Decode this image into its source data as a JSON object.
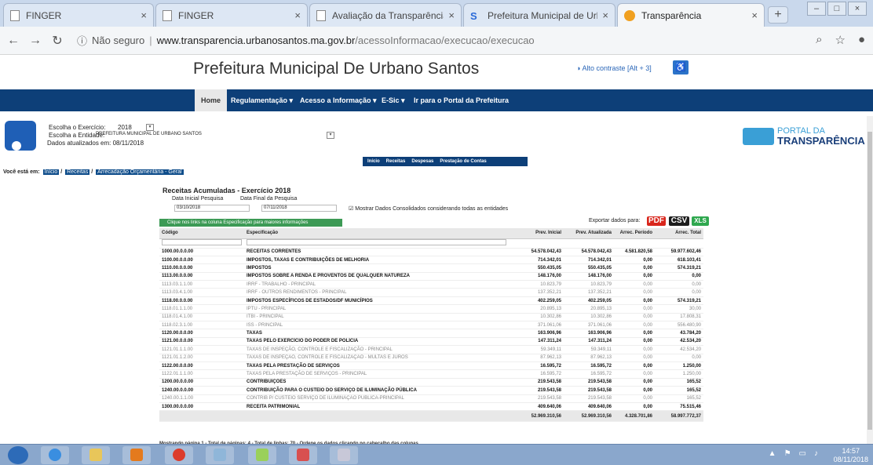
{
  "browser": {
    "tabs": [
      {
        "label": "FINGER",
        "icon": "page-icon",
        "active": false
      },
      {
        "label": "FINGER",
        "icon": "page-icon",
        "active": false
      },
      {
        "label": "Avaliação da Transparência dos",
        "icon": "page-icon",
        "active": false
      },
      {
        "label": "Prefeitura Municipal de Urbano",
        "icon": "site-icon",
        "active": false
      },
      {
        "label": "Transparência",
        "icon": "info-icon",
        "active": true
      }
    ],
    "security_label": "Não seguro",
    "url_host": "www.transparencia.urbanosantos.ma.gov.br",
    "url_path": "/acessoInformacao/execucao/execucao"
  },
  "site": {
    "title": "Prefeitura Municipal De Urbano Santos",
    "contrast_label": "Alto contraste [Alt + 3]",
    "nav": [
      "Home",
      "Regulamentação",
      "Acesso a Informação",
      "E-Sic",
      "Ir para o Portal da Prefeitura"
    ]
  },
  "portal": {
    "exercicio_label": "Escolha o Exercício:",
    "exercicio_value": "2018",
    "entidade_label": "Escolha a Entidade:",
    "entidade_value": "PREFEITURA MUNICIPAL DE URBANO SANTOS",
    "updated": "Dados atualizados em: 08/11/2018",
    "logo_line1": "PORTAL DA",
    "logo_line2": "TRANSPARÊNCIA",
    "subnav": [
      "Início",
      "Receitas",
      "Despesas",
      "Prestação de Contas"
    ],
    "breadcrumb_label": "Você está em:",
    "breadcrumb": [
      "Início",
      "Receitas",
      "Arrecadação Orçamentária - Geral"
    ]
  },
  "report": {
    "title": "Receitas Acumuladas - Exercício 2018",
    "data_inicial_label": "Data Inicial Pesquisa",
    "data_inicial": "03/10/2018",
    "data_final_label": "Data Final da Pesquisa",
    "data_final": "07/11/2018",
    "consolidado_label": "Mostrar Dados Consolidados considerando todas as entidades",
    "hint": "Clique nos links na coluna Especificação para maiores informações",
    "export_label": "Exportar dados para:",
    "export_buttons": [
      "PDF",
      "CSV",
      "XLS"
    ],
    "colors": {
      "pdf": "#d9261c",
      "csv": "#1d1d1d",
      "xls": "#2fa84f",
      "nav": "#0d3f78"
    },
    "columns": [
      "Código",
      "Especificação",
      "Prev. Inicial",
      "Prev. Atualizada",
      "Arrec. Período",
      "Arrec. Total"
    ],
    "rows": [
      {
        "level": 1,
        "cells": [
          "1000.00.0.0.00",
          "RECEITAS CORRENTES",
          "54.578.042,43",
          "54.578.042,43",
          "4.581.820,58",
          "59.977.602,46"
        ]
      },
      {
        "level": 1,
        "cells": [
          "1100.00.0.0.00",
          "IMPOSTOS, TAXAS E CONTRIBUIÇÕES DE MELHORIA",
          "714.342,01",
          "714.342,01",
          "0,00",
          "618.103,41"
        ]
      },
      {
        "level": 1,
        "cells": [
          "1110.00.0.0.00",
          "IMPOSTOS",
          "550.435,05",
          "550.435,05",
          "0,00",
          "574.319,21"
        ]
      },
      {
        "level": 1,
        "cells": [
          "1113.00.0.0.00",
          "IMPOSTOS SOBRE A RENDA E PROVENTOS DE QUALQUER NATUREZA",
          "148.176,00",
          "148.176,00",
          "0,00",
          "0,00"
        ]
      },
      {
        "level": 2,
        "cells": [
          "1113.03.1.1.00",
          "IRRF - TRABALHO - PRINCIPAL",
          "10.823,79",
          "10.823,79",
          "0,00",
          "0,00"
        ]
      },
      {
        "level": 2,
        "cells": [
          "1113.03.4.1.00",
          "IRRF - OUTROS RENDIMENTOS - PRINCIPAL",
          "137.352,21",
          "137.352,21",
          "0,00",
          "0,00"
        ]
      },
      {
        "level": 1,
        "cells": [
          "1118.00.0.0.00",
          "IMPOSTOS ESPECÍFICOS DE ESTADOS/DF MUNICÍPIOS",
          "402.259,05",
          "402.259,05",
          "0,00",
          "574.319,21"
        ]
      },
      {
        "level": 2,
        "cells": [
          "1118.01.1.1.00",
          "IPTU - PRINCIPAL",
          "20.895,13",
          "20.895,13",
          "0,00",
          "30,00"
        ]
      },
      {
        "level": 2,
        "cells": [
          "1118.01.4.1.00",
          "ITBI - PRINCIPAL",
          "10.302,86",
          "10.302,86",
          "0,00",
          "17.808,31"
        ]
      },
      {
        "level": 2,
        "cells": [
          "1118.02.3.1.00",
          "ISS - PRINCIPAL",
          "371.061,06",
          "371.061,06",
          "0,00",
          "556.480,90"
        ]
      },
      {
        "level": 1,
        "cells": [
          "1120.00.0.0.00",
          "TAXAS",
          "163.906,96",
          "163.906,96",
          "0,00",
          "43.784,20"
        ]
      },
      {
        "level": 1,
        "cells": [
          "1121.00.0.0.00",
          "TAXAS PELO EXERCÍCIO DO PODER DE POLÍCIA",
          "147.311,24",
          "147.311,24",
          "0,00",
          "42.534,20"
        ]
      },
      {
        "level": 2,
        "cells": [
          "1121.01.1.1.00",
          "TAXAS DE INSPEÇÃO, CONTROLE E FISCALIZAÇÃO - PRINCIPAL",
          "59.349,11",
          "59.349,11",
          "0,00",
          "42.534,20"
        ]
      },
      {
        "level": 2,
        "cells": [
          "1121.01.1.2.00",
          "TAXAS DE INSPEÇÃO, CONTROLE E FISCALIZAÇÃO - MULTAS E JUROS",
          "87.962,13",
          "87.962,13",
          "0,00",
          "0,00"
        ]
      },
      {
        "level": 1,
        "cells": [
          "1122.00.0.0.00",
          "TAXAS PELA PRESTAÇÃO DE SERVIÇOS",
          "16.595,72",
          "16.595,72",
          "0,00",
          "1.250,00"
        ]
      },
      {
        "level": 2,
        "cells": [
          "1122.01.1.1.00",
          "TAXAS PELA PRESTAÇÃO DE SERVIÇOS - PRINCIPAL",
          "16.595,72",
          "16.595,72",
          "0,00",
          "1.250,00"
        ]
      },
      {
        "level": 1,
        "cells": [
          "1200.00.0.0.00",
          "CONTRIBUIÇÕES",
          "219.543,58",
          "219.543,58",
          "0,00",
          "165,52"
        ]
      },
      {
        "level": 1,
        "cells": [
          "1240.00.0.0.00",
          "CONTRIBUIÇÃO PARA O CUSTEIO DO SERVIÇO DE ILUMINAÇÃO PÚBLICA",
          "219.543,58",
          "219.543,58",
          "0,00",
          "165,52"
        ]
      },
      {
        "level": 2,
        "cells": [
          "1240.00.1.1.00",
          "CONTRIB P/ CUSTEIO SERVIÇO DE ILUMINAÇÃO PÚBLICA-PRINCIPAL",
          "219.543,58",
          "219.543,58",
          "0,00",
          "165,52"
        ]
      },
      {
        "level": 1,
        "cells": [
          "1300.00.0.0.00",
          "RECEITA PATRIMONIAL",
          "409.640,06",
          "409.640,06",
          "0,00",
          "75.515,46"
        ]
      }
    ],
    "totals": [
      "",
      "",
      "52.969.310,56",
      "52.969.310,56",
      "4.328.701,86",
      "58.997.772,37"
    ],
    "pager": "Mostrando página 1 - Total de páginas: 4 - Total de linhas: 70 - Ordene os dados clicando no cabeçalho das colunas"
  },
  "taskbar": {
    "time": "14:57",
    "date": "08/11/2018"
  }
}
